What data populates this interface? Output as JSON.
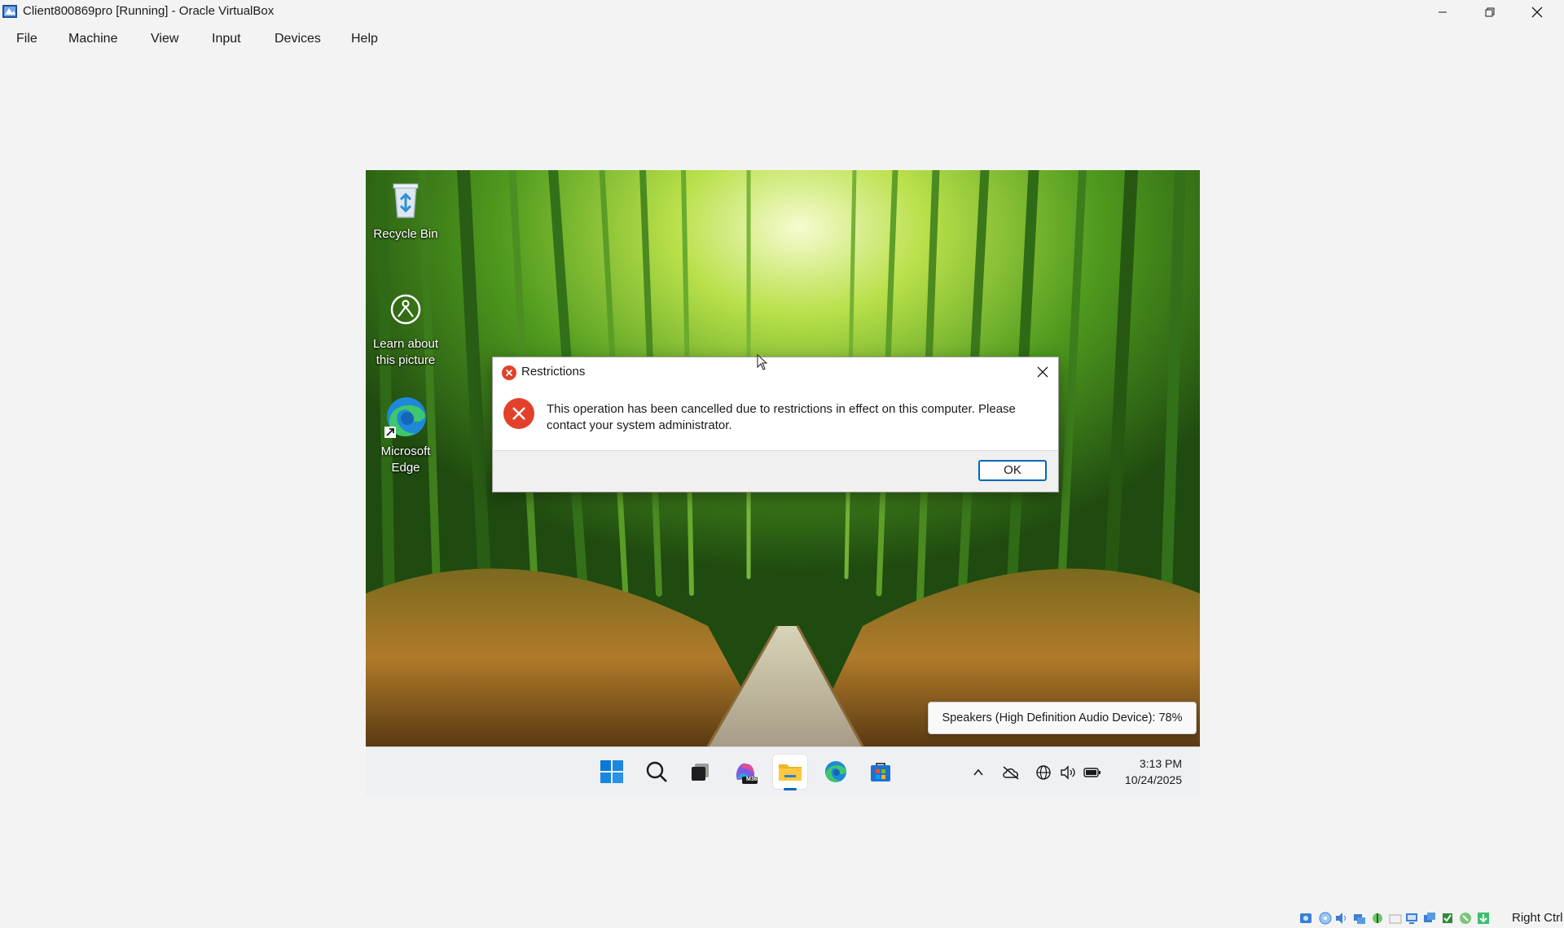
{
  "window": {
    "title": "Client800869pro [Running] - Oracle VirtualBox",
    "controls": [
      "minimize",
      "restore",
      "close"
    ]
  },
  "menubar": {
    "items": [
      {
        "label": "File"
      },
      {
        "label": "Machine"
      },
      {
        "label": "View"
      },
      {
        "label": "Input"
      },
      {
        "label": "Devices"
      },
      {
        "label": "Help"
      }
    ]
  },
  "desktop": {
    "icons": [
      {
        "name": "recycle-bin-icon",
        "label": "Recycle Bin"
      },
      {
        "name": "learn-picture-icon",
        "label": "Learn about this picture"
      },
      {
        "name": "edge-icon",
        "label": "Microsoft Edge"
      }
    ]
  },
  "dialog": {
    "title": "Restrictions",
    "message": "This operation has been cancelled due to restrictions in effect on this computer. Please contact your system administrator.",
    "ok_label": "OK"
  },
  "tooltip": {
    "text": "Speakers (High Definition Audio Device): 78%"
  },
  "taskbar": {
    "apps": [
      "start-icon",
      "search-icon",
      "task-view-icon",
      "m365-copilot-icon",
      "file-explorer-icon",
      "edge-icon",
      "store-icon"
    ],
    "m365_badge": "M365",
    "active_app": "file-explorer-icon",
    "tray": [
      "chevron-up-icon",
      "onedrive-icon",
      "network-icon",
      "volume-icon",
      "battery-icon"
    ],
    "time": "3:13 PM",
    "date": "10/24/2025"
  },
  "statusbar": {
    "host_key": "Right Ctrl"
  },
  "colors": {
    "accent": "#0067c0",
    "error": "#e3402a",
    "host_bg": "#f3f3f3"
  }
}
